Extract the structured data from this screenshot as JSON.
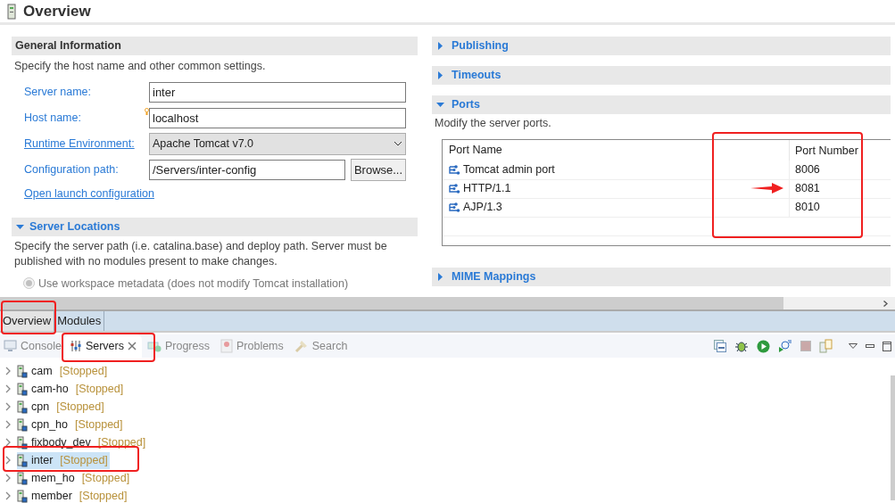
{
  "editor": {
    "title": "Overview"
  },
  "general": {
    "title": "General Information",
    "description": "Specify the host name and other common settings.",
    "fields": [
      {
        "kind": "text",
        "label": "Server name:",
        "value": "inter",
        "link": false,
        "decorated": false
      },
      {
        "kind": "text",
        "label": "Host name:",
        "value": "localhost",
        "link": false,
        "decorated": true
      },
      {
        "kind": "select",
        "label": "Runtime Environment:",
        "value": "Apache Tomcat v7.0",
        "link": true,
        "decorated": false
      },
      {
        "kind": "browse",
        "label": "Configuration path:",
        "value": "/Servers/inter-config",
        "button": "Browse...",
        "link": false,
        "decorated": false
      }
    ],
    "link": "Open launch configuration"
  },
  "locations": {
    "title": "Server Locations",
    "expanded": true,
    "description": "Specify the server path (i.e. catalina.base) and deploy path. Server must be published with no modules present to make changes.",
    "options": [
      {
        "label": "Use workspace metadata (does not modify Tomcat installation)",
        "selected": true,
        "disabled": true
      }
    ]
  },
  "sections": [
    {
      "title": "Publishing",
      "expanded": false
    },
    {
      "title": "Timeouts",
      "expanded": false
    },
    {
      "title": "Ports",
      "expanded": true,
      "description": "Modify the server ports.",
      "table": {
        "columns": [
          "Port Name",
          "Port Number"
        ],
        "rows": [
          [
            "Tomcat admin port",
            "8006"
          ],
          [
            "HTTP/1.1",
            "8081"
          ],
          [
            "AJP/1.3",
            "8010"
          ]
        ]
      }
    },
    {
      "title": "MIME Mappings",
      "expanded": false
    }
  ],
  "editor_tabs": [
    {
      "label": "Overview",
      "selected": true
    },
    {
      "label": "Modules",
      "selected": false
    }
  ],
  "view_tabs": [
    {
      "kind": "console",
      "label": "Console",
      "selected": false
    },
    {
      "kind": "servers",
      "label": "Servers",
      "selected": true
    },
    {
      "kind": "progress",
      "label": "Progress",
      "selected": false
    },
    {
      "kind": "problems",
      "label": "Problems",
      "selected": false
    },
    {
      "kind": "search",
      "label": "Search",
      "selected": false
    }
  ],
  "servers": [
    {
      "name": "cam",
      "status": "[Stopped]",
      "selected": false
    },
    {
      "name": "cam-ho",
      "status": "[Stopped]",
      "selected": false
    },
    {
      "name": "cpn",
      "status": "[Stopped]",
      "selected": false
    },
    {
      "name": "cpn_ho",
      "status": "[Stopped]",
      "selected": false
    },
    {
      "name": "fixbody_dev",
      "status": "[Stopped]",
      "selected": false
    },
    {
      "name": "inter",
      "status": "[Stopped]",
      "selected": true
    },
    {
      "name": "mem_ho",
      "status": "[Stopped]",
      "selected": false
    },
    {
      "name": "member",
      "status": "[Stopped]",
      "selected": false
    }
  ]
}
